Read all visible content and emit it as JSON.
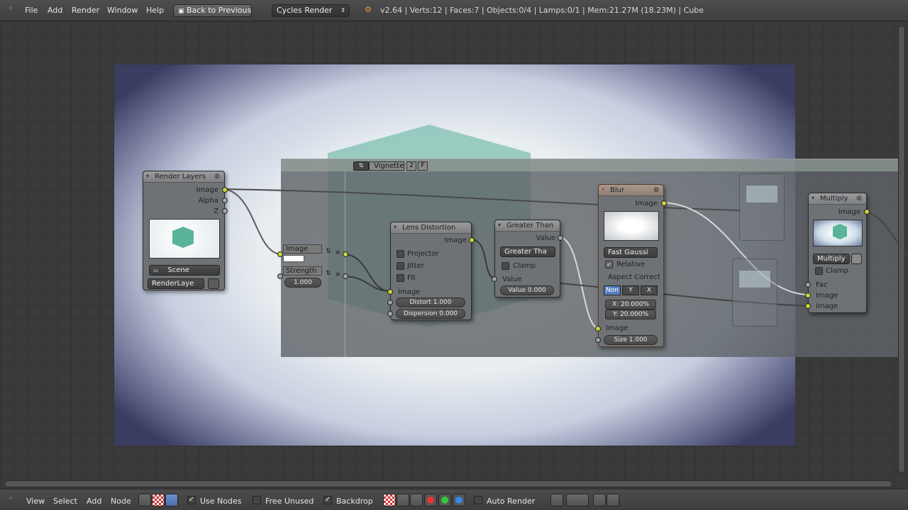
{
  "menu": {
    "file": "File",
    "add": "Add",
    "render": "Render",
    "window": "Window",
    "help": "Help"
  },
  "back_button": "Back to Previous",
  "render_engine": "Cycles Render",
  "status_info": "v2.64 | Verts:12 | Faces:7 | Objects:0/4 | Lamps:0/1 | Mem:21.27M (18.23M) | Cube",
  "frame": {
    "label": "Vignette",
    "users": "2",
    "fake_user": "F"
  },
  "render_layers": {
    "title": "Render Layers",
    "out_image": "Image",
    "out_alpha": "Alpha",
    "out_z": "Z",
    "scene": "Scene",
    "layer": "RenderLaye"
  },
  "image_node": {
    "image": "Image",
    "strength": "Strength",
    "strength_val": "1.000"
  },
  "lens": {
    "title": "Lens Distortion",
    "out_image": "Image",
    "projector": "Projector",
    "jitter": "Jitter",
    "fit": "Fit",
    "in_image": "Image",
    "distort": "Distort 1.000",
    "dispersion": "Dispersion 0.000"
  },
  "greater": {
    "title": "Greater Than",
    "out_value": "Value",
    "operation": "Greater Tha",
    "clamp": "Clamp",
    "in_value": "Value",
    "value_field": "Value 0.000"
  },
  "blur": {
    "title": "Blur",
    "out_image": "Image",
    "filter": "Fast Gaussi",
    "relative": "Relative",
    "aspect": "Aspect Correct",
    "aspect_none": "Non",
    "aspect_y": "Y",
    "aspect_x": "X",
    "x": "X: 20.000%",
    "y": "Y: 20.000%",
    "in_image": "Image",
    "size": "Size 1.000"
  },
  "multiply": {
    "title": "Multiply",
    "out_image": "Image",
    "blend": "Multiply",
    "clamp": "Clamp",
    "fac": "Fac",
    "in_image1": "Image",
    "in_image2": "Image"
  },
  "bottom": {
    "view": "View",
    "select": "Select",
    "add": "Add",
    "node": "Node",
    "use_nodes": "Use Nodes",
    "free_unused": "Free Unused",
    "backdrop": "Backdrop",
    "auto_render": "Auto Render"
  },
  "colors": {
    "socket_image": "#c7d43a",
    "socket_value": "#a1a1a1",
    "cube": "#5aaf9b",
    "frame": "#5f6469"
  }
}
